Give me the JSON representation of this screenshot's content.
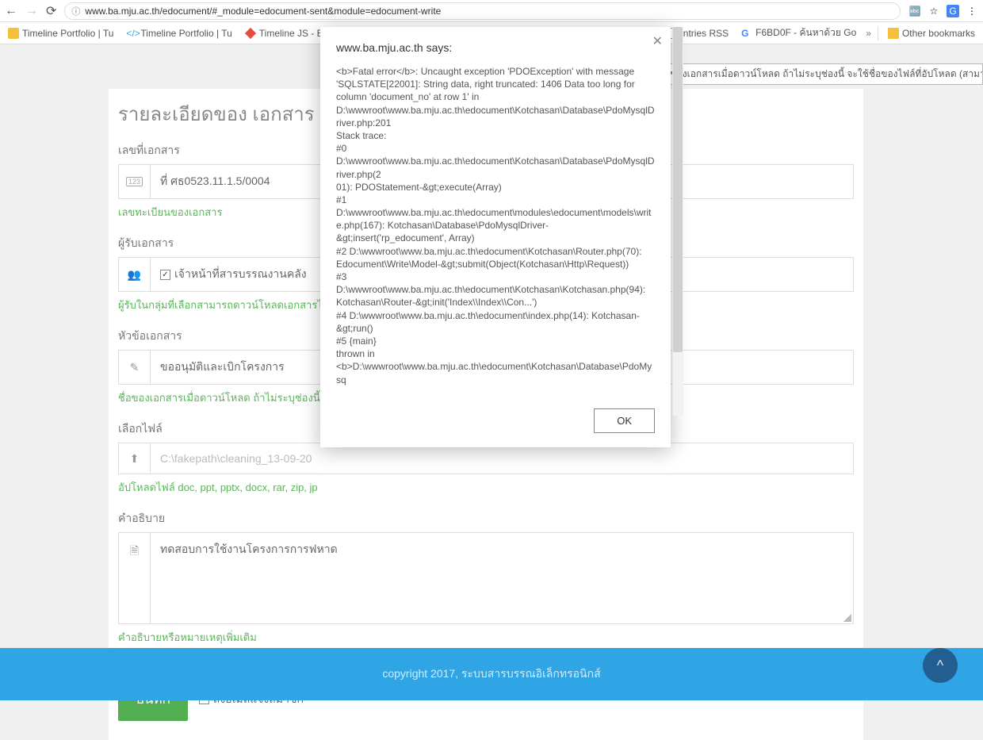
{
  "browser": {
    "url": "www.ba.mju.ac.th/edocument/#_module=edocument-sent&module=edocument-write",
    "info_icon": "ⓘ"
  },
  "bookmarks": {
    "items": [
      {
        "label": "Timeline Portfolio | Tu"
      },
      {
        "label": "Timeline Portfolio | Tu"
      },
      {
        "label": "Timeline JS - B"
      },
      {
        "label": "Entries RSS"
      },
      {
        "label": "F6BD0F - ค้นหาด้วย Go"
      }
    ],
    "more": "»",
    "other": "Other bookmarks"
  },
  "tooltip": "ชื่อของเอกสารเมื่อดาวน์โหลด ถ้าไม่ระบุช่องนี้ จะใช้ชื่อของไฟล์ที่อัปโหลด (สามารถใช้ภาษาไทยไ",
  "form": {
    "title": "รายละเอียดของ เอกสาร",
    "docno_label": "เลขที่เอกสาร",
    "docno_icon": "123",
    "docno_value": "ที่ ศธ0523.11.1.5/0004",
    "docno_hint": "เลขทะเบียนของเอกสาร",
    "receiver_label": "ผู้รับเอกสาร",
    "receiver_cb1": "เจ้าหน้าที่สารบรรณงานคลัง",
    "receiver_hint": "ผู้รับในกลุ่มที่เลือกสามารถดาวน์โหลดเอกสารได้ (ส",
    "subject_label": "หัวข้อเอกสาร",
    "subject_value": "ขออนุมัติและเบิกโครงการ",
    "subject_hint": "ชื่อของเอกสารเมื่อดาวน์โหลด ถ้าไม่ระบุช่องนี้ จะใ",
    "file_label": "เลือกไฟล์",
    "file_value": "C:\\fakepath\\cleaning_13-09-20",
    "file_hint": "อัปโหลดไฟล์ doc, ppt, pptx, docx, rar, zip, jp",
    "desc_label": "คำอธิบาย",
    "desc_value": "ทดสอบการใช้งานโครงการการฟหาด",
    "desc_hint": "คำอธิบายหรือหมายเหตุเพิ่มเติม",
    "save_btn": "บันทึก",
    "mail_cb": "ส่งอีเมล์แจ้งสมาชิก"
  },
  "dialog": {
    "title": "www.ba.mju.ac.th says:",
    "ok": "OK",
    "error_lines": [
      "<b>Fatal error</b>:  Uncaught exception 'PDOException' with message 'SQLSTATE[22001]: String data, right truncated: 1406 Data too long for column 'document_no' at row 1' in D:\\wwwroot\\www.ba.mju.ac.th\\edocument\\Kotchasan\\Database\\PdoMysqlDriver.php:201",
      "Stack trace:",
      "#0 D:\\wwwroot\\www.ba.mju.ac.th\\edocument\\Kotchasan\\Database\\PdoMysqlDriver.php(2",
      "01): PDOStatement-&gt;execute(Array)",
      "#1 D:\\wwwroot\\www.ba.mju.ac.th\\edocument\\modules\\edocument\\models\\write.php(167): Kotchasan\\Database\\PdoMysqlDriver-&gt;insert('rp_edocument', Array)",
      "#2 D:\\wwwroot\\www.ba.mju.ac.th\\edocument\\Kotchasan\\Router.php(70): Edocument\\Write\\Model-&gt;submit(Object(Kotchasan\\Http\\Request))",
      "#3 D:\\wwwroot\\www.ba.mju.ac.th\\edocument\\Kotchasan\\Kotchasan.php(94): Kotchasan\\Router-&gt;init('Index\\\\Index\\\\Con...')",
      "#4 D:\\wwwroot\\www.ba.mju.ac.th\\edocument\\index.php(14): Kotchasan-&gt;run()",
      "#5 {main}",
      "  thrown in <b>D:\\wwwroot\\www.ba.mju.ac.th\\edocument\\Kotchasan\\Database\\PdoMysq"
    ]
  },
  "footer": "copyright 2017, ระบบสารบรรณอิเล็กทรอนิกส์",
  "fab": "^"
}
